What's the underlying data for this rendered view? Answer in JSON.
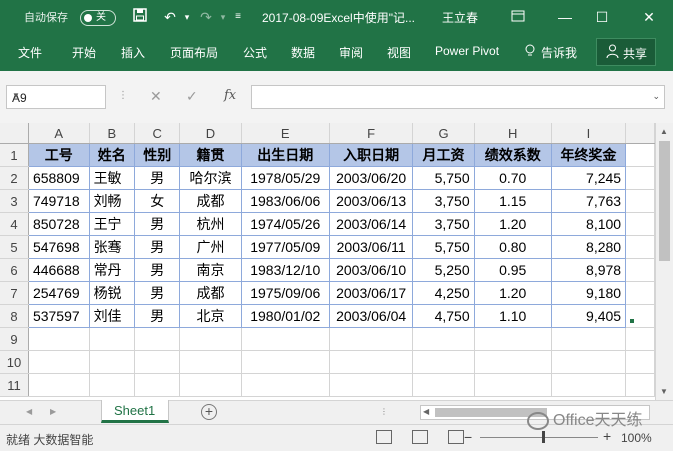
{
  "titlebar": {
    "autosave_label": "自动保存",
    "autosave_state": "关",
    "filename": "2017-08-09Excel中使用\"记...",
    "user": "王立春",
    "icons": [
      "save-icon",
      "undo-icon",
      "redo-icon",
      "customize-icon",
      "ribbon-display-icon",
      "minimize-icon",
      "maximize-icon",
      "close-icon"
    ]
  },
  "ribbon": {
    "tabs": [
      "文件",
      "开始",
      "插入",
      "页面布局",
      "公式",
      "数据",
      "审阅",
      "视图",
      "Power Pivot"
    ],
    "tell_me": "告诉我",
    "share": "共享"
  },
  "formula_bar": {
    "name_box": "A9",
    "fx": "fx",
    "cancel": "✕",
    "enter": "✓",
    "formula": ""
  },
  "sheet": {
    "columns": [
      "A",
      "B",
      "C",
      "D",
      "E",
      "F",
      "G",
      "H",
      "I"
    ],
    "rows": [
      "1",
      "2",
      "3",
      "4",
      "5",
      "6",
      "7",
      "8",
      "9",
      "10",
      "11"
    ],
    "header": [
      "工号",
      "姓名",
      "性别",
      "籍贯",
      "出生日期",
      "入职日期",
      "月工资",
      "绩效系数",
      "年终奖金"
    ],
    "data": [
      [
        "658809",
        "王敏",
        "男",
        "哈尔滨",
        "1978/05/29",
        "2003/06/20",
        "5,750",
        "0.70",
        "7,245"
      ],
      [
        "749718",
        "刘畅",
        "女",
        "成都",
        "1983/06/06",
        "2003/06/13",
        "3,750",
        "1.15",
        "7,763"
      ],
      [
        "850728",
        "王宁",
        "男",
        "杭州",
        "1974/05/26",
        "2003/06/14",
        "3,750",
        "1.20",
        "8,100"
      ],
      [
        "547698",
        "张骞",
        "男",
        "广州",
        "1977/05/09",
        "2003/06/11",
        "5,750",
        "0.80",
        "8,280"
      ],
      [
        "446688",
        "常丹",
        "男",
        "南京",
        "1983/12/10",
        "2003/06/10",
        "5,250",
        "0.95",
        "8,978"
      ],
      [
        "254769",
        "杨锐",
        "男",
        "成都",
        "1975/09/06",
        "2003/06/17",
        "4,250",
        "1.20",
        "9,180"
      ],
      [
        "537597",
        "刘佳",
        "男",
        "北京",
        "1980/01/02",
        "2003/06/04",
        "4,750",
        "1.10",
        "9,405"
      ]
    ],
    "header_fill": "#b4c6e7",
    "border_color": "#8ea9db"
  },
  "sheet_tabs": {
    "active": "Sheet1"
  },
  "status": {
    "text": "就绪 大数据智能",
    "zoom": "100%"
  },
  "watermark": "Office天天练",
  "accent": "#217346"
}
